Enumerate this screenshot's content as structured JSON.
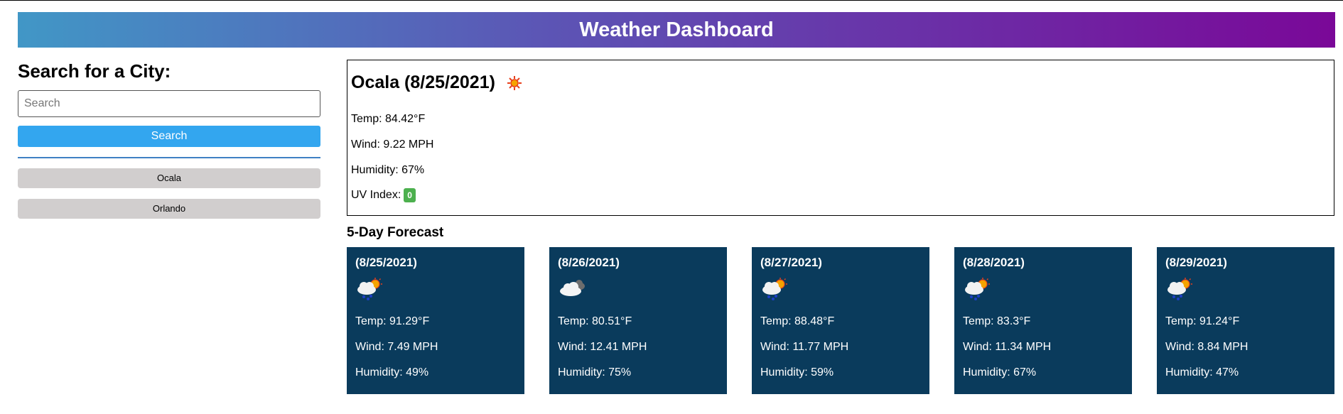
{
  "header": {
    "title": "Weather Dashboard"
  },
  "sidebar": {
    "heading": "Search for a City:",
    "search_placeholder": "Search",
    "search_value": "",
    "search_button": "Search",
    "history": [
      "Ocala",
      "Orlando"
    ]
  },
  "current": {
    "title": "Ocala (8/25/2021)",
    "icon": "sun-icon",
    "temp": "Temp: 84.42°F",
    "wind": "Wind: 9.22 MPH",
    "humidity": "Humidity: 67%",
    "uv_label": "UV Index:",
    "uv_value": "0",
    "uv_color": "#4cb04e"
  },
  "forecast": {
    "title": "5-Day Forecast",
    "days": [
      {
        "date": "(8/25/2021)",
        "icon": "rain-sun-icon",
        "temp": "Temp: 91.29°F",
        "wind": "Wind: 7.49 MPH",
        "humidity": "Humidity: 49%"
      },
      {
        "date": "(8/26/2021)",
        "icon": "cloud-icon",
        "temp": "Temp: 80.51°F",
        "wind": "Wind: 12.41 MPH",
        "humidity": "Humidity: 75%"
      },
      {
        "date": "(8/27/2021)",
        "icon": "rain-sun-icon",
        "temp": "Temp: 88.48°F",
        "wind": "Wind: 11.77 MPH",
        "humidity": "Humidity: 59%"
      },
      {
        "date": "(8/28/2021)",
        "icon": "rain-sun-icon",
        "temp": "Temp: 83.3°F",
        "wind": "Wind: 11.34 MPH",
        "humidity": "Humidity: 67%"
      },
      {
        "date": "(8/29/2021)",
        "icon": "rain-sun-icon",
        "temp": "Temp: 91.24°F",
        "wind": "Wind: 8.84 MPH",
        "humidity": "Humidity: 47%"
      }
    ]
  },
  "colors": {
    "header_start": "#4197c6",
    "header_end": "#7a0898",
    "search_button": "#33a6ef",
    "card_bg": "#0a3b5c",
    "history_bg": "#d1cece"
  }
}
